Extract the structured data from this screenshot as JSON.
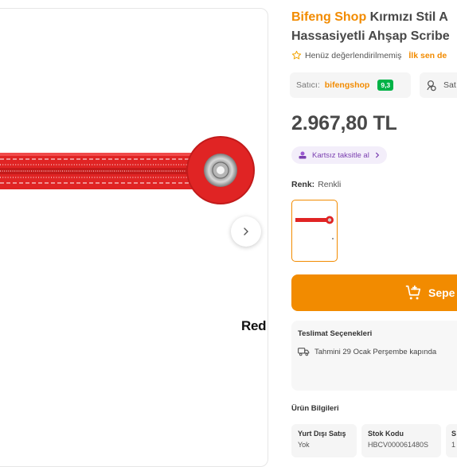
{
  "product": {
    "brand": "Bifeng Shop",
    "title_rest_line1": "Kırmızı Stil A",
    "title_line2": "Hassasiyetli Ahşap Scribe",
    "image_caption": "Red"
  },
  "rating": {
    "text": "Henüz değerlendirilmemiş",
    "first_review": "İlk sen de"
  },
  "seller": {
    "label": "Satıcı:",
    "name": "bifengshop",
    "score": "9,3",
    "follow_label": "Sat"
  },
  "price": "2.967,80 TL",
  "installment": "Kartsız taksitle al",
  "color": {
    "label": "Renk:",
    "value": "Renkli"
  },
  "cart_button": "Sepe",
  "delivery": {
    "title": "Teslimat Seçenekleri",
    "estimate": "Tahmini 29 Ocak Perşembe kapında"
  },
  "product_info": {
    "title": "Ürün Bilgileri",
    "cells": [
      {
        "header": "Yurt Dışı Satış",
        "value": "Yok"
      },
      {
        "header": "Stok Kodu",
        "value": "HBCV000061480S"
      },
      {
        "header": "S",
        "value": "1"
      }
    ]
  },
  "colors": {
    "accent": "#f28b00",
    "product_red": "#e02424",
    "score_green": "#00b246",
    "installment_purple": "#7b3fb0"
  },
  "icons": [
    "chevron-right-icon",
    "star-outline-icon",
    "follow-icon",
    "wallet-icon",
    "cart-add-icon",
    "truck-icon"
  ]
}
